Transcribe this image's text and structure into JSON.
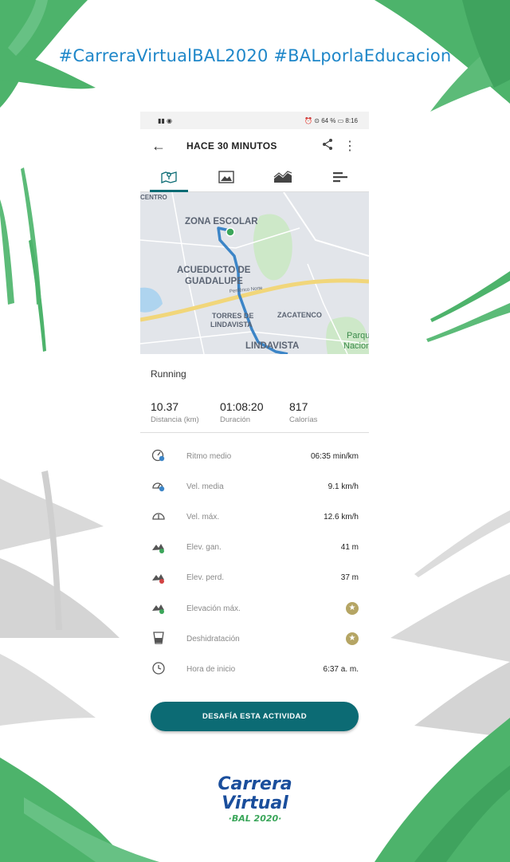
{
  "banner": {
    "hashtag": "#CarreraVirtualBAL2020 #BALporlaEducacion"
  },
  "colors": {
    "accent": "#0c6b74",
    "green": "#4db36b",
    "gray": "#d4d4d4",
    "hashtag": "#1f87c9"
  },
  "statusbar": {
    "right_text": "⏰ ⊙ 64 % ▭ 8:16"
  },
  "appbar": {
    "back_icon": "arrow-left-icon",
    "title": "HACE 30 MINUTOS",
    "share_icon": "share-icon",
    "more_icon": "more-vert-icon"
  },
  "tabs": [
    {
      "icon": "map-icon",
      "active": true
    },
    {
      "icon": "image-icon",
      "active": false
    },
    {
      "icon": "chart-icon",
      "active": false
    },
    {
      "icon": "bars-icon",
      "active": false
    }
  ],
  "map": {
    "labels": {
      "centro": "CENTRO",
      "zona_escolar": "ZONA ESCOLAR",
      "acueducto": "ACUEDUCTO DE",
      "guadalupe": "GUADALUPE",
      "torres": "TORRES DE",
      "lindavista_small": "LINDAVISTA",
      "zacatenco": "ZACATENCO",
      "lindavista": "LINDAVISTA",
      "parque": "Parqu",
      "nacion": "Nacion",
      "road": "Periférico Norte"
    }
  },
  "activity": {
    "sport": "Running"
  },
  "stats": [
    {
      "value": "10.37",
      "label": "Distancia (km)"
    },
    {
      "value": "01:08:20",
      "label": "Duración"
    },
    {
      "value": "817",
      "label": "Calorías"
    }
  ],
  "metrics": [
    {
      "icon": "pace-icon",
      "label": "Ritmo medio",
      "value": "06:35 min/km"
    },
    {
      "icon": "speed-avg-icon",
      "label": "Vel. media",
      "value": "9.1 km/h"
    },
    {
      "icon": "speed-max-icon",
      "label": "Vel. máx.",
      "value": "12.6 km/h"
    },
    {
      "icon": "elevation-gain-icon",
      "label": "Elev. gan.",
      "value": "41 m"
    },
    {
      "icon": "elevation-loss-icon",
      "label": "Elev. perd.",
      "value": "37 m"
    },
    {
      "icon": "elevation-max-icon",
      "label": "Elevación máx.",
      "value": "★"
    },
    {
      "icon": "hydration-icon",
      "label": "Deshidratación",
      "value": "★"
    },
    {
      "icon": "clock-icon",
      "label": "Hora de inicio",
      "value": "6:37 a. m."
    }
  ],
  "cta": {
    "label": "DESAFÍA ESTA ACTIVIDAD"
  },
  "logo": {
    "line1": "Carrera",
    "line2": "Virtual",
    "line3": "·BAL 2020·"
  }
}
